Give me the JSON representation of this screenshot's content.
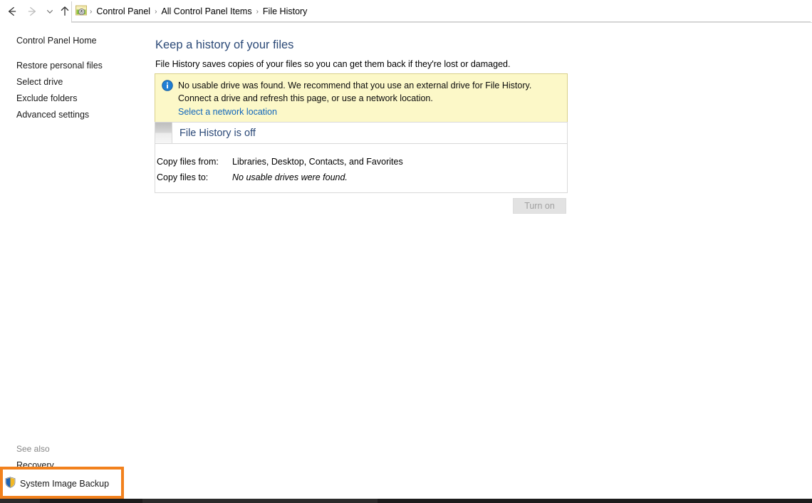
{
  "window": {
    "nav": {
      "back_label": "Back",
      "forward_label": "Forward",
      "recent_label": "Recent locations",
      "up_label": "Up one level"
    },
    "address": {
      "icon": "control-panel-icon",
      "separator": "›",
      "breadcrumbs": [
        "Control Panel",
        "All Control Panel Items",
        "File History"
      ]
    }
  },
  "sidebar": {
    "home_label": "Control Panel Home",
    "items": [
      {
        "label": "Restore personal files"
      },
      {
        "label": "Select drive"
      },
      {
        "label": "Exclude folders"
      },
      {
        "label": "Advanced settings"
      }
    ],
    "see_also_label": "See also",
    "see_also_items": [
      {
        "label": "Recovery",
        "icon": null
      },
      {
        "label": "System Image Backup",
        "icon": "shield-icon"
      }
    ]
  },
  "main": {
    "title": "Keep a history of your files",
    "subtitle": "File History saves copies of your files so you can get them back if they're lost or damaged.",
    "notice": {
      "icon": "info-icon",
      "text": "No usable drive was found. We recommend that you use an external drive for File History. Connect a drive and refresh this page, or use a network location.",
      "link_label": "Select a network location"
    },
    "status": {
      "heading": "File History is off",
      "rows": [
        {
          "label": "Copy files from:",
          "value": "Libraries, Desktop, Contacts, and Favorites",
          "italic": false
        },
        {
          "label": "Copy files to:",
          "value": "No usable drives were found.",
          "italic": true
        }
      ]
    },
    "turn_on_button": {
      "label": "Turn on",
      "enabled": false
    }
  },
  "annotation": {
    "highlight_target": "System Image Backup",
    "highlight_color": "#f2811d"
  },
  "colors": {
    "accent_heading": "#2b4977",
    "link": "#1166bb",
    "notice_bg": "#fcf8c8",
    "notice_border": "#d9d08a",
    "highlight": "#f2811d"
  }
}
